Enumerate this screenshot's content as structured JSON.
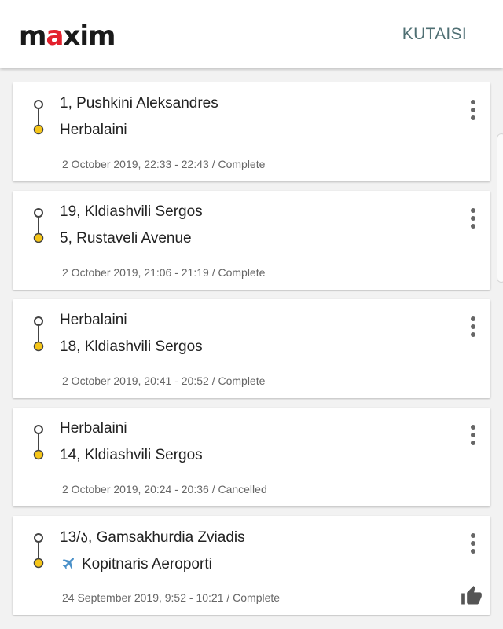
{
  "app": {
    "logo": "maxim",
    "city": "KUTAISI"
  },
  "trips": [
    {
      "from": "1, Pushkini Aleksandres",
      "to": "Herbalaini",
      "meta": "2 October 2019, 22:33 - 22:43 / Complete",
      "to_icon": "",
      "rated": false
    },
    {
      "from": "19, Kldiashvili Sergos",
      "to": "5, Rustaveli Avenue",
      "meta": "2 October 2019, 21:06 - 21:19 / Complete",
      "to_icon": "",
      "rated": false
    },
    {
      "from": "Herbalaini",
      "to": "18, Kldiashvili Sergos",
      "meta": "2 October 2019, 20:41 - 20:52 / Complete",
      "to_icon": "",
      "rated": false
    },
    {
      "from": "Herbalaini",
      "to": "14, Kldiashvili Sergos",
      "meta": "2 October 2019, 20:24 - 20:36 / Cancelled",
      "to_icon": "",
      "rated": false
    },
    {
      "from": "13/ა, Gamsakhurdia Zviadis",
      "to": "Kopitnaris Aeroporti",
      "meta": "24 September 2019, 9:52 - 10:21 / Complete",
      "to_icon": "airplane-icon",
      "rated": true
    }
  ],
  "colors": {
    "accent": "#e3212d",
    "dest_dot": "#f5c518",
    "city": "#4f6f73"
  }
}
